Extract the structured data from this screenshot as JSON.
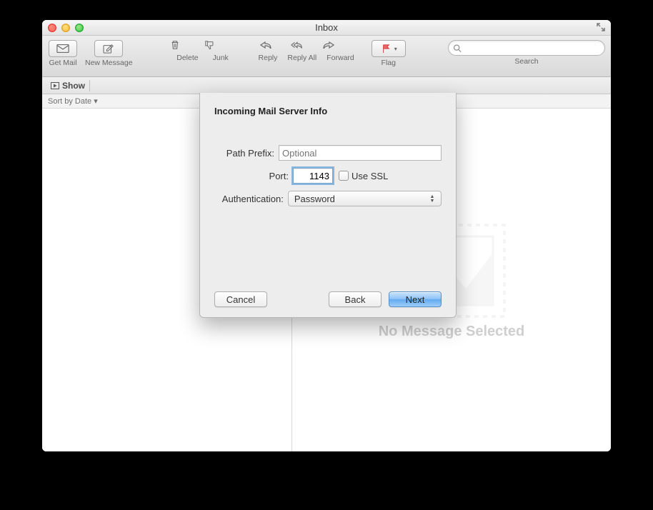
{
  "window": {
    "title": "Inbox"
  },
  "toolbar": {
    "get_mail": "Get Mail",
    "new_message": "New Message",
    "delete": "Delete",
    "junk": "Junk",
    "reply": "Reply",
    "reply_all": "Reply All",
    "forward": "Forward",
    "flag": "Flag",
    "search_label": "Search",
    "search_placeholder": ""
  },
  "filter": {
    "show": "Show"
  },
  "sort": {
    "label": "Sort by Date ▾"
  },
  "preview": {
    "no_message": "No Message Selected"
  },
  "sheet": {
    "title": "Incoming Mail Server Info",
    "path_prefix_label": "Path Prefix:",
    "path_prefix_placeholder": "Optional",
    "path_prefix_value": "",
    "port_label": "Port:",
    "port_value": "1143",
    "use_ssl_label": "Use SSL",
    "use_ssl_checked": false,
    "auth_label": "Authentication:",
    "auth_value": "Password",
    "cancel": "Cancel",
    "back": "Back",
    "next": "Next"
  }
}
